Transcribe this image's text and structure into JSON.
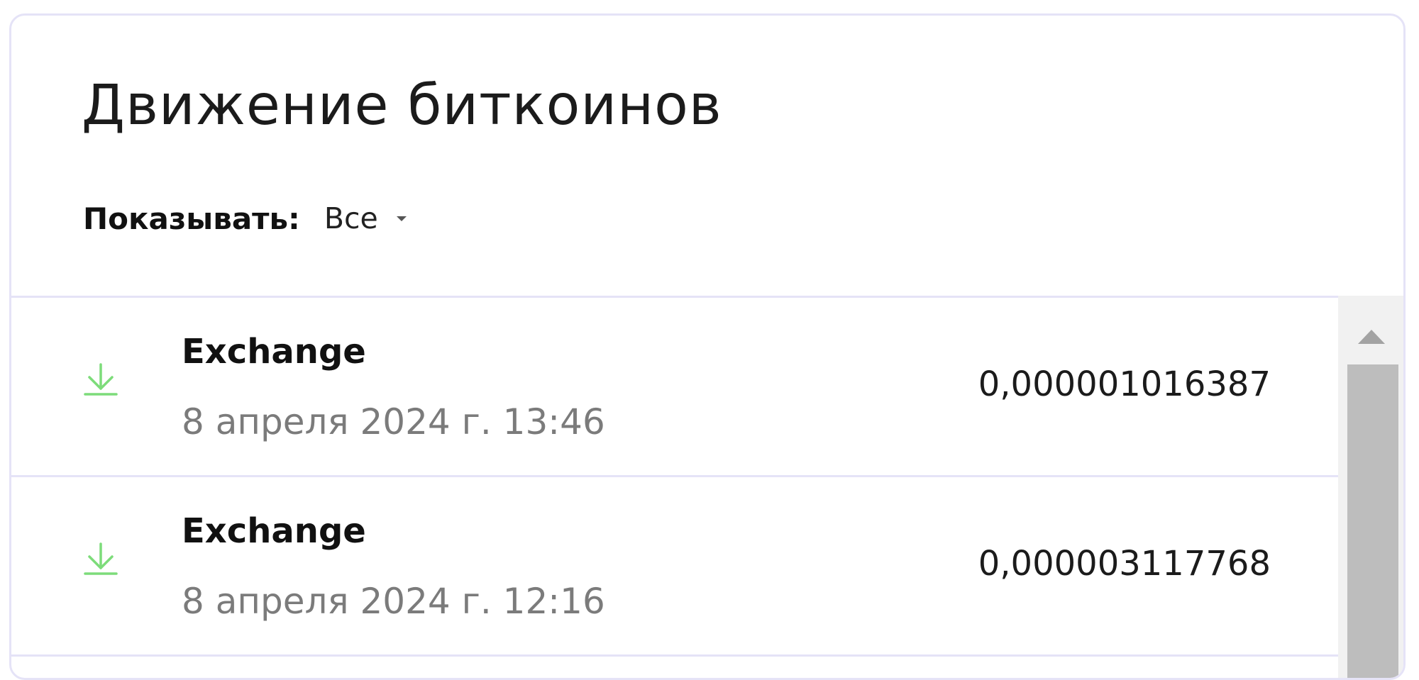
{
  "panel": {
    "title": "Движение биткоинов",
    "filter": {
      "label": "Показывать:",
      "selected": "Все"
    }
  },
  "colors": {
    "incoming_icon": "#7ddc7a",
    "border": "#e5e3f7",
    "date_text": "#7b7b7b"
  },
  "transactions": [
    {
      "type": "Exchange",
      "date": "8 апреля 2024 г. 13:46",
      "amount": "0,000001016387",
      "icon": "download-arrow-icon"
    },
    {
      "type": "Exchange",
      "date": "8 апреля 2024 г. 12:16",
      "amount": "0,000003117768",
      "icon": "download-arrow-icon"
    }
  ]
}
